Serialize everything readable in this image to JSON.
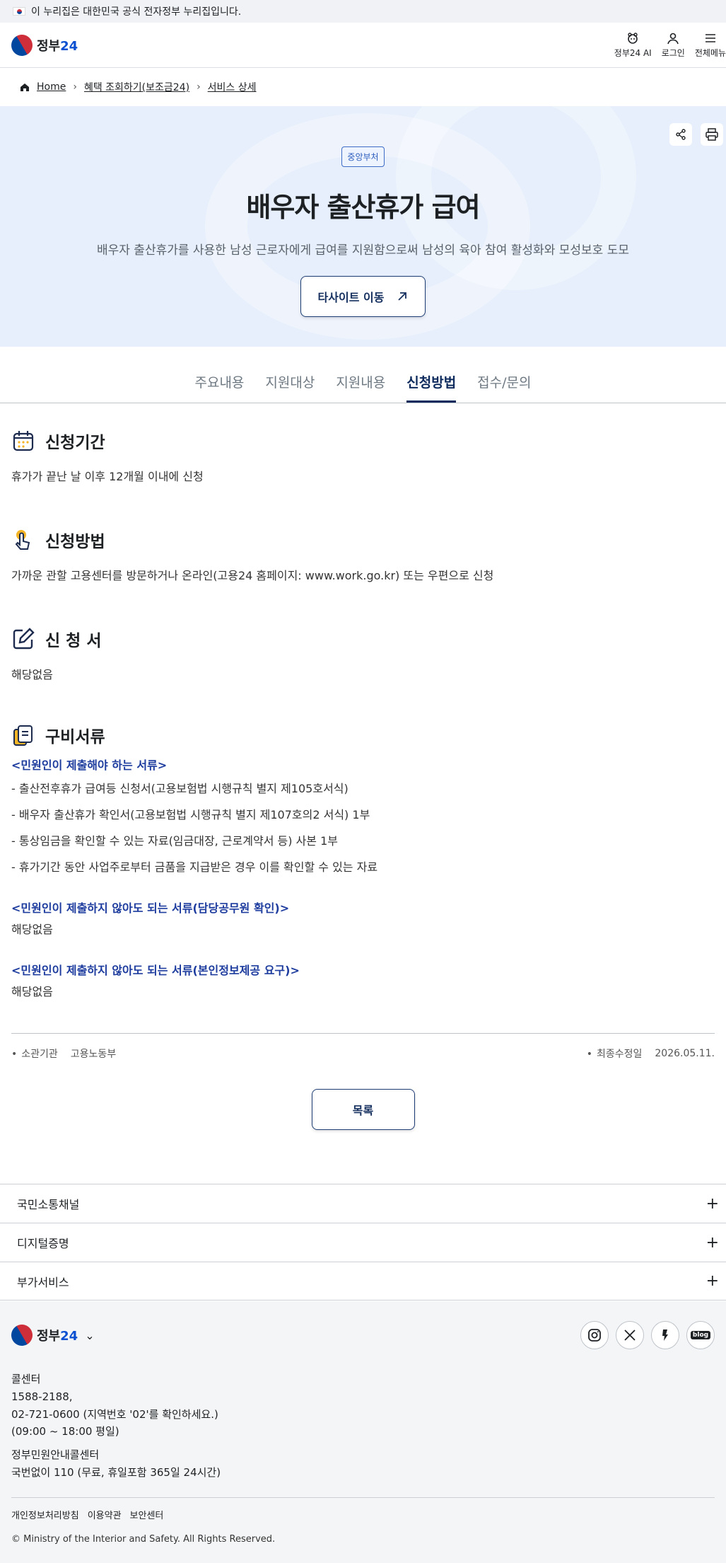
{
  "notice": "이 누리집은 대한민국 공식 전자정부 누리집입니다.",
  "header": {
    "logo_text": "정부",
    "logo_num": "24",
    "ai_label": "정부24 AI",
    "login_label": "로그인",
    "menu_label": "전체메뉴"
  },
  "breadcrumb": {
    "home": "Home",
    "level1": "혜택 조회하기(보조금24)",
    "level2": "서비스 상세"
  },
  "hero": {
    "badge": "중앙부처",
    "title": "배우자 출산휴가 급여",
    "description": "배우자 출산휴가를 사용한 남성 근로자에게 급여를 지원함으로써 남성의 육아 참여 활성화와 모성보호 도모",
    "site_button": "타사이트 이동"
  },
  "tabs": [
    {
      "label": "주요내용"
    },
    {
      "label": "지원대상"
    },
    {
      "label": "지원내용"
    },
    {
      "label": "신청방법"
    },
    {
      "label": "접수/문의"
    }
  ],
  "sections": {
    "period": {
      "title": "신청기간",
      "body": "휴가가 끝난 날 이후 12개월 이내에 신청"
    },
    "method": {
      "title": "신청방법",
      "body": "가까운 관할 고용센터를 방문하거나 온라인(고용24 홈페이지: www.work.go.kr) 또는 우편으로 신청"
    },
    "form": {
      "title": "신 청 서",
      "body": "해당없음"
    },
    "docs": {
      "title": "구비서류",
      "submit_title": "<민원인이 제출해야 하는 서류>",
      "submit_items": [
        "- 출산전후휴가 급여등 신청서(고용보험법 시행규칙 별지 제105호서식)",
        "- 배우자 출산휴가 확인서(고용보험법 시행규칙 별지 제107호의2 서식) 1부",
        "- 통상임금을 확인할 수 있는 자료(임금대장, 근로계약서 등) 사본 1부",
        "- 휴가기간 동안 사업주로부터 금품을 지급받은 경우 이를 확인할 수 있는 자료"
      ],
      "official_title": "<민원인이 제출하지 않아도 되는 서류(담당공무원 확인)>",
      "official_body": "해당없음",
      "consent_title": "<민원인이 제출하지 않아도 되는 서류(본인정보제공 요구)>",
      "consent_body": "해당없음"
    }
  },
  "meta": {
    "agency_label": "소관기관",
    "agency_value": "고용노동부",
    "updated_label": "최종수정일",
    "updated_value": "2026.05.11."
  },
  "list_button": "목록",
  "accordions": [
    {
      "label": "국민소통채널"
    },
    {
      "label": "디지털증명"
    },
    {
      "label": "부가서비스"
    }
  ],
  "footer": {
    "sns": {
      "blog": "blog"
    },
    "call_title": "콜센터",
    "call_line1": "1588-2188,",
    "call_line2": "02-721-0600 (지역번호 '02'를 확인하세요.)",
    "call_line3": "(09:00 ~ 18:00 평일)",
    "center_title": "정부민원안내콜센터",
    "center_line": "국번없이 110 (무료, 휴일포함 365일 24시간)",
    "links": [
      "개인정보처리방침",
      "이용약관",
      "보안센터"
    ],
    "copyright": "© Ministry of the Interior and Safety. All Rights Reserved."
  }
}
